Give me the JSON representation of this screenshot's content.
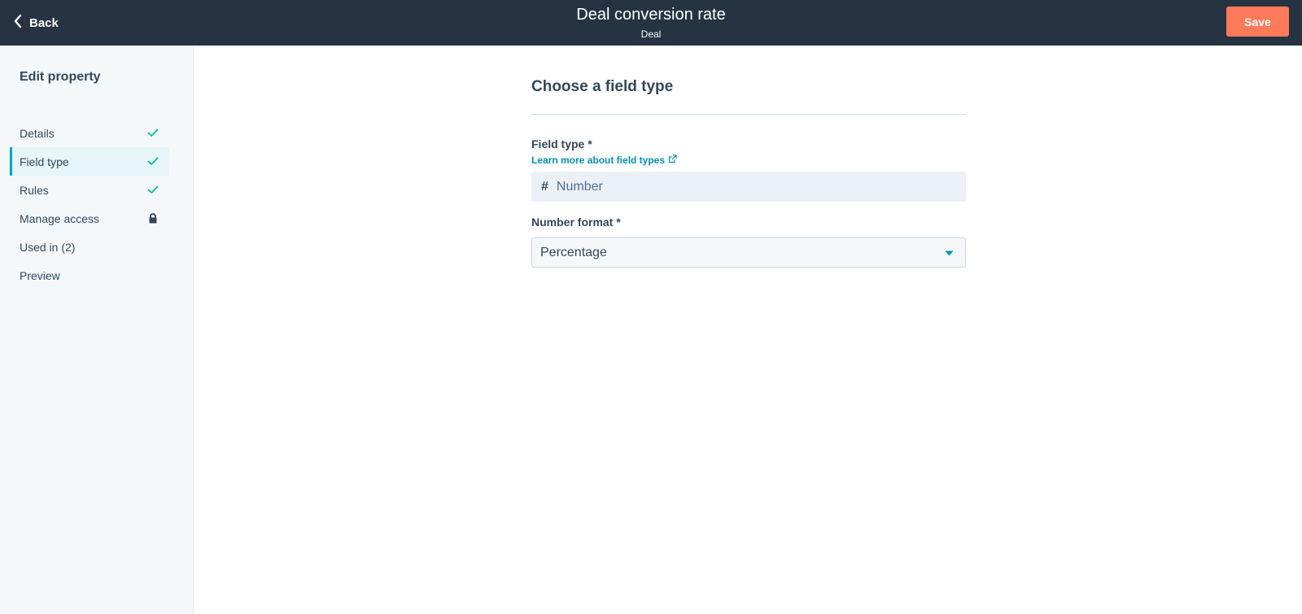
{
  "header": {
    "back_label": "Back",
    "title": "Deal conversion rate",
    "subtitle": "Deal",
    "save_label": "Save"
  },
  "sidebar": {
    "heading": "Edit property",
    "items": [
      {
        "label": "Details",
        "icon": "check-icon"
      },
      {
        "label": "Field type",
        "icon": "check-icon",
        "active": true
      },
      {
        "label": "Rules",
        "icon": "check-icon"
      },
      {
        "label": "Manage access",
        "icon": "lock-icon"
      },
      {
        "label": "Used in (2)"
      },
      {
        "label": "Preview"
      }
    ]
  },
  "main": {
    "section_title": "Choose a field type",
    "field_type_label": "Field type *",
    "learn_more_link": "Learn more about field types",
    "field_type_value": "Number",
    "number_format_label": "Number format *",
    "number_format_value": "Percentage"
  },
  "colors": {
    "topbar": "#253342",
    "accent_save": "#ff7a59",
    "teal": "#00a4bd",
    "link": "#0091ae"
  }
}
